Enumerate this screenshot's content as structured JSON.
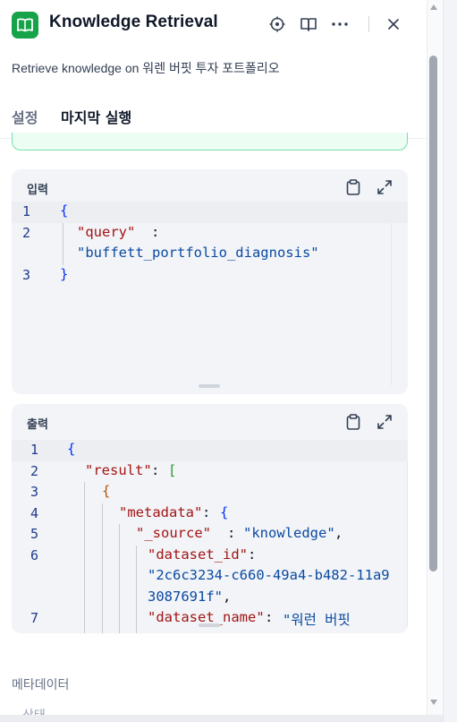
{
  "header": {
    "title": "Knowledge Retrieval",
    "app_icon": "book-icon",
    "brand_color": "#16a34a",
    "actions": [
      "target-icon",
      "book-open-icon",
      "more-icon",
      "close-icon"
    ]
  },
  "description": "Retrieve knowledge on 워렌 버핏 투자 포트폴리오",
  "tabs": [
    {
      "label": "설정",
      "active": false
    },
    {
      "label": "마지막 실행",
      "active": true
    }
  ],
  "input_panel": {
    "label": "입력",
    "lines": [
      {
        "num": "1",
        "text": "{"
      },
      {
        "num": "2",
        "key": "\"query\"",
        "punct": ":"
      },
      {
        "num": "",
        "str": "\"buffett_portfolio_diagnosis\""
      },
      {
        "num": "3",
        "text": "}"
      }
    ]
  },
  "output_panel": {
    "label": "출력",
    "lines": [
      {
        "num": "1",
        "text": "{"
      },
      {
        "num": "2",
        "key": "\"result\"",
        "punct": ": ",
        "bracket": "["
      },
      {
        "num": "3",
        "text": "{"
      },
      {
        "num": "4",
        "key": "\"metadata\"",
        "punct": ": ",
        "brace": "{"
      },
      {
        "num": "5",
        "key": "\"_source\"",
        "punct": ": ",
        "str": "\"knowledge\"",
        "tail": ","
      },
      {
        "num": "6",
        "key": "\"dataset_id\"",
        "punct": ":"
      },
      {
        "num": "",
        "str": "\"2c6c3234-c660-49a4-b482-11a9"
      },
      {
        "num": "",
        "str": "3087691f\"",
        "tail": ","
      },
      {
        "num": "7",
        "key": "\"dataset_name\"",
        "punct": ": ",
        "str": "\"워런 버핏"
      }
    ]
  },
  "metadata_label": "메타데이터",
  "cut_text": "상태"
}
